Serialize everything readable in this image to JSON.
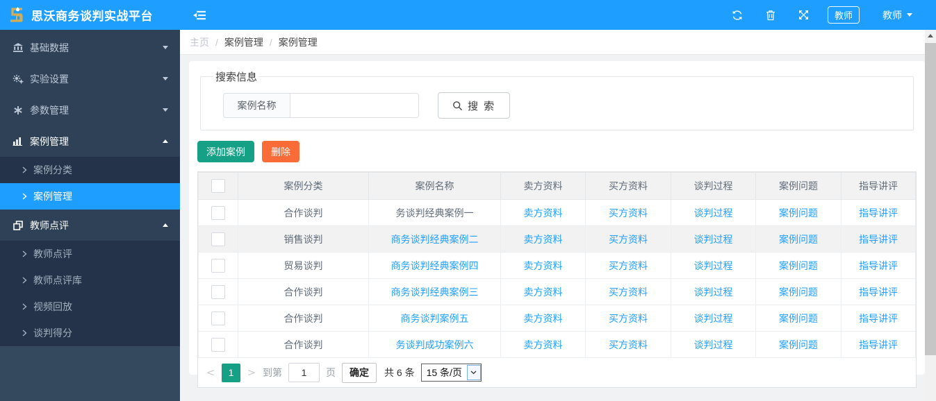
{
  "app_title": "思沃商务谈判实战平台",
  "colors": {
    "accent_blue": "#1e9fff",
    "teal_button": "#16a085",
    "orange_button": "#f96b37",
    "sidebar_dark": "#2f4156"
  },
  "header": {
    "icons": [
      "collapse-menu-icon",
      "refresh-icon",
      "trash-icon",
      "fullscreen-icon"
    ],
    "role_badge": "教师",
    "username": "教师"
  },
  "breadcrumb": {
    "separator": "/",
    "items": [
      "主页",
      "案例管理",
      "案例管理"
    ]
  },
  "sidebar": {
    "groups": [
      {
        "label": "基础数据",
        "icon": "bank-icon",
        "expanded": false,
        "children": []
      },
      {
        "label": "实验设置",
        "icon": "gears-icon",
        "expanded": false,
        "children": []
      },
      {
        "label": "参数管理",
        "icon": "asterisk-icon",
        "expanded": false,
        "children": []
      },
      {
        "label": "案例管理",
        "icon": "bar-chart-icon",
        "expanded": true,
        "children": [
          "案例分类",
          "案例管理"
        ],
        "active_child": "案例管理"
      },
      {
        "label": "教师点评",
        "icon": "clone-icon",
        "expanded": true,
        "children": [
          "教师点评",
          "教师点评库",
          "视频回放",
          "谈判得分"
        ]
      }
    ]
  },
  "search_panel": {
    "legend": "搜索信息",
    "field_label": "案例名称",
    "field_value": "",
    "search_button": "搜 索"
  },
  "toolbar": {
    "add_button": "添加案例",
    "delete_button": "删除"
  },
  "table": {
    "columns": [
      "案例分类",
      "案例名称",
      "卖方资料",
      "买方资料",
      "谈判过程",
      "案例问题",
      "指导讲评"
    ],
    "highlighted_row_index": 1,
    "rows": [
      {
        "category": "合作谈判",
        "name": "务谈判经典案例一",
        "name_is_link": false,
        "links": [
          "卖方资料",
          "买方资料",
          "谈判过程",
          "案例问题",
          "指导讲评"
        ]
      },
      {
        "category": "销售谈判",
        "name": "商务谈判经典案例二",
        "name_is_link": true,
        "links": [
          "卖方资料",
          "买方资料",
          "谈判过程",
          "案例问题",
          "指导讲评"
        ]
      },
      {
        "category": "贸易谈判",
        "name": "商务谈判经典案例四",
        "name_is_link": true,
        "links": [
          "卖方资料",
          "买方资料",
          "谈判过程",
          "案例问题",
          "指导讲评"
        ]
      },
      {
        "category": "合作谈判",
        "name": "商务谈判经典案例三",
        "name_is_link": true,
        "links": [
          "卖方资料",
          "买方资料",
          "谈判过程",
          "案例问题",
          "指导讲评"
        ]
      },
      {
        "category": "合作谈判",
        "name": "商务谈判案例五",
        "name_is_link": true,
        "links": [
          "卖方资料",
          "买方资料",
          "谈判过程",
          "案例问题",
          "指导讲评"
        ]
      },
      {
        "category": "合作谈判",
        "name": "务谈判成功案例六",
        "name_is_link": true,
        "links": [
          "卖方资料",
          "买方资料",
          "谈判过程",
          "案例问题",
          "指导讲评"
        ]
      }
    ]
  },
  "pagination": {
    "prev": "<",
    "page": "1",
    "next": ">",
    "goto_label": "到第",
    "goto_value": "1",
    "goto_unit": "页",
    "confirm_button": "确定",
    "total_text": "共 6 条",
    "page_size": "15 条/页"
  }
}
